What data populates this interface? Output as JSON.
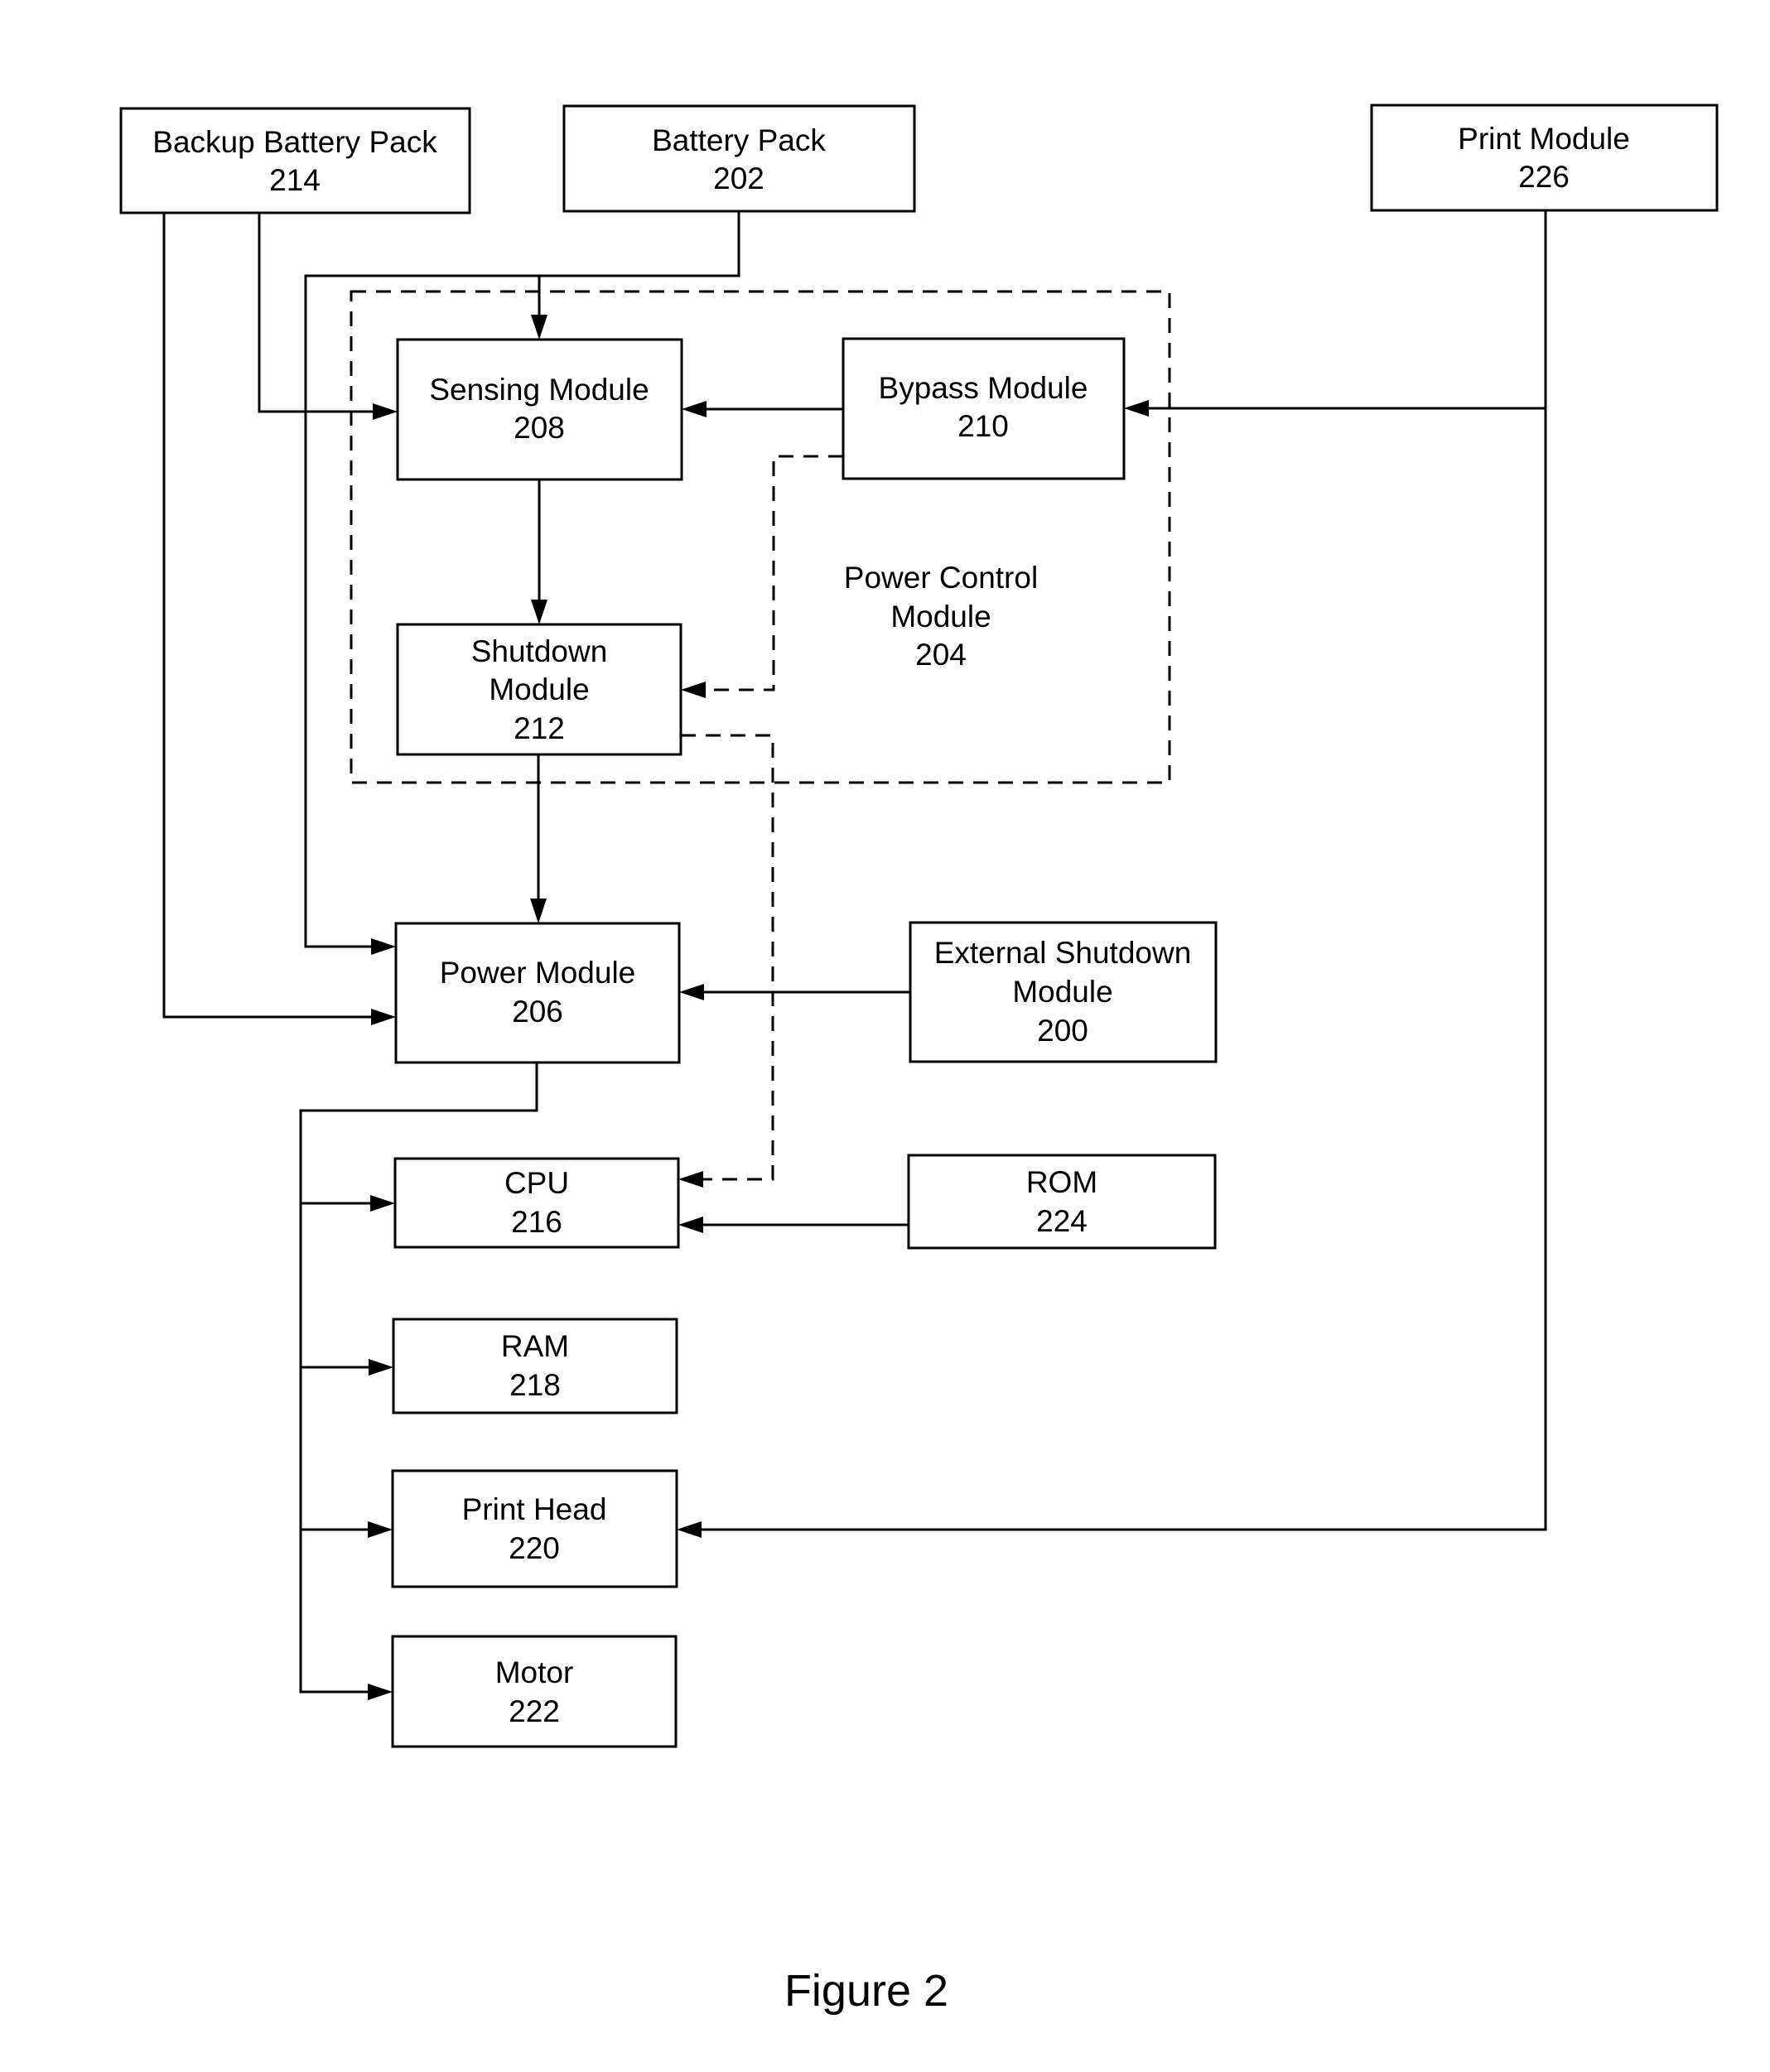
{
  "figure_caption": "Figure 2",
  "container": {
    "id": "power-control-module",
    "lines": [
      "Power Control",
      "Module",
      "204"
    ]
  },
  "blocks": [
    {
      "id": "backup-battery-pack",
      "lines": [
        "Backup Battery Pack",
        "214"
      ]
    },
    {
      "id": "battery-pack",
      "lines": [
        "Battery Pack",
        "202"
      ]
    },
    {
      "id": "print-module",
      "lines": [
        "Print Module",
        "226"
      ]
    },
    {
      "id": "sensing-module",
      "lines": [
        "Sensing Module",
        "208"
      ]
    },
    {
      "id": "bypass-module",
      "lines": [
        "Bypass Module",
        "210"
      ]
    },
    {
      "id": "shutdown-module",
      "lines": [
        "Shutdown",
        "Module",
        "212"
      ]
    },
    {
      "id": "power-module",
      "lines": [
        "Power Module",
        "206"
      ]
    },
    {
      "id": "external-shutdown-module",
      "lines": [
        "External Shutdown",
        "Module",
        "200"
      ]
    },
    {
      "id": "cpu",
      "lines": [
        "CPU",
        "216"
      ]
    },
    {
      "id": "rom",
      "lines": [
        "ROM",
        "224"
      ]
    },
    {
      "id": "ram",
      "lines": [
        "RAM",
        "218"
      ]
    },
    {
      "id": "print-head",
      "lines": [
        "Print Head",
        "220"
      ]
    },
    {
      "id": "motor",
      "lines": [
        "Motor",
        "222"
      ]
    }
  ],
  "connections": [
    {
      "from": "battery-pack",
      "to": "sensing-module",
      "style": "solid"
    },
    {
      "from": "battery-pack",
      "to": "power-module",
      "style": "solid"
    },
    {
      "from": "backup-battery-pack",
      "to": "sensing-module",
      "style": "solid"
    },
    {
      "from": "backup-battery-pack",
      "to": "power-module",
      "style": "solid"
    },
    {
      "from": "bypass-module",
      "to": "sensing-module",
      "style": "solid"
    },
    {
      "from": "print-module",
      "to": "bypass-module",
      "style": "solid"
    },
    {
      "from": "print-module",
      "to": "print-head",
      "style": "solid"
    },
    {
      "from": "sensing-module",
      "to": "shutdown-module",
      "style": "solid"
    },
    {
      "from": "bypass-module",
      "to": "shutdown-module",
      "style": "dashed"
    },
    {
      "from": "shutdown-module",
      "to": "power-module",
      "style": "solid"
    },
    {
      "from": "shutdown-module",
      "to": "cpu",
      "style": "dashed"
    },
    {
      "from": "external-shutdown-module",
      "to": "power-module",
      "style": "solid"
    },
    {
      "from": "rom",
      "to": "cpu",
      "style": "solid"
    },
    {
      "from": "power-module",
      "to": "cpu",
      "style": "solid"
    },
    {
      "from": "power-module",
      "to": "ram",
      "style": "solid"
    },
    {
      "from": "power-module",
      "to": "print-head",
      "style": "solid"
    },
    {
      "from": "power-module",
      "to": "motor",
      "style": "solid"
    }
  ]
}
